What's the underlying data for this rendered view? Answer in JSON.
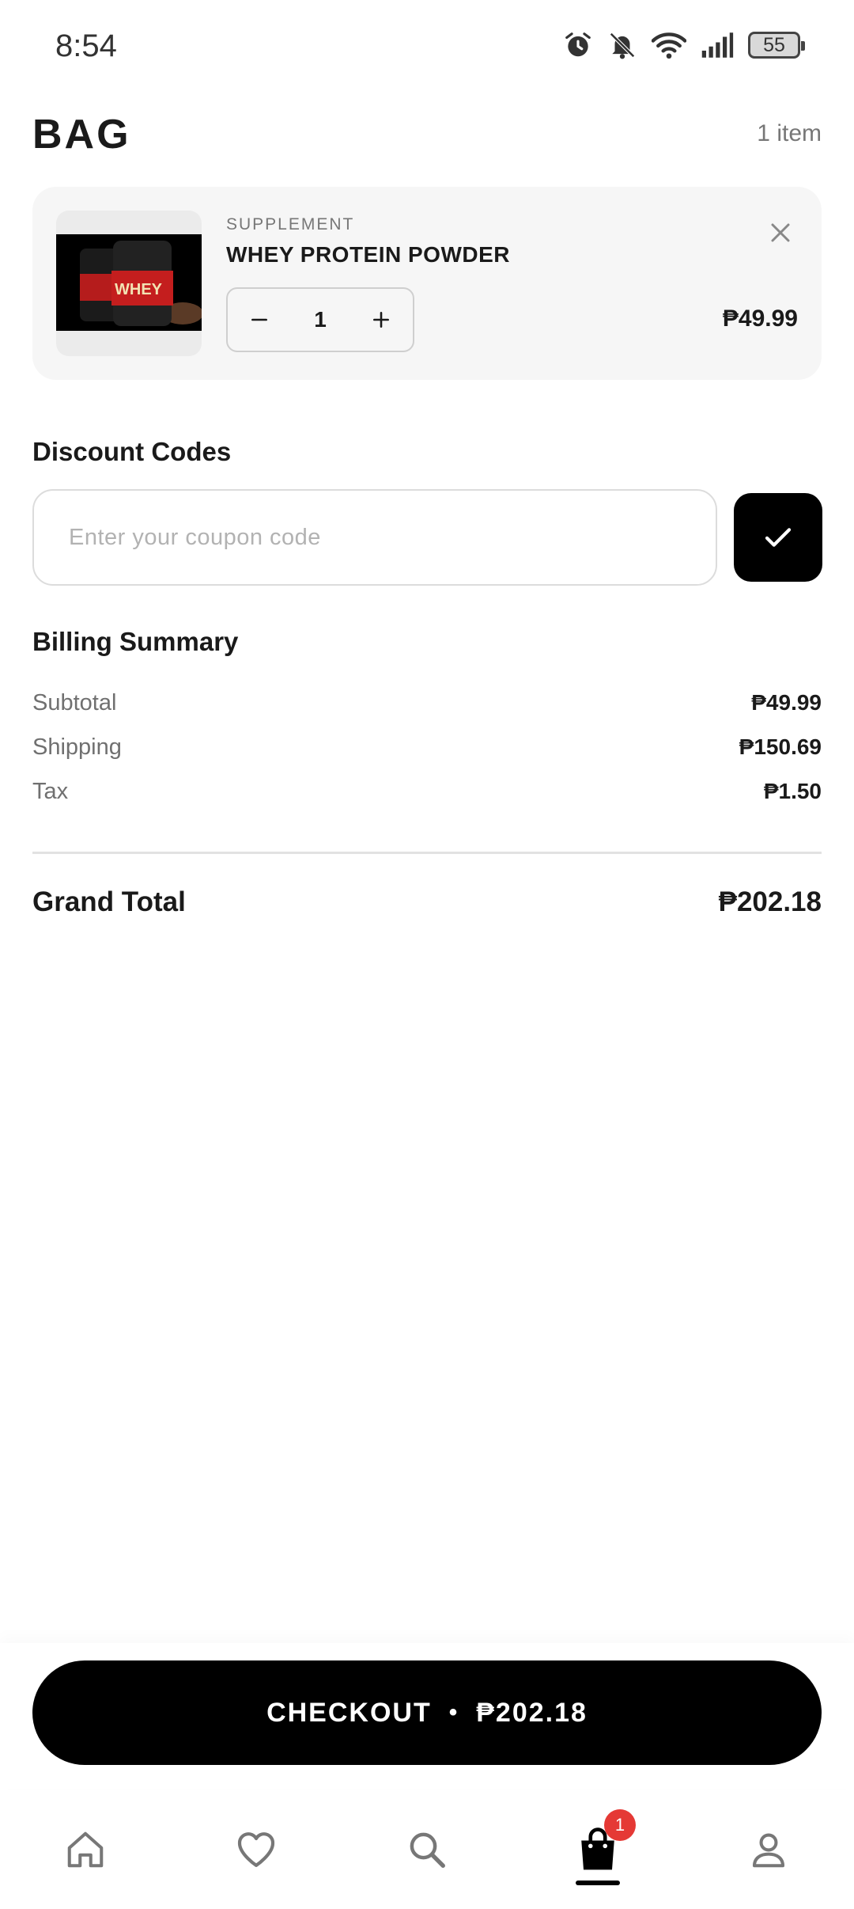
{
  "status_bar": {
    "time": "8:54",
    "battery": "55",
    "icons": [
      "alarm-icon",
      "bell-off-icon",
      "wifi-icon",
      "signal-icon",
      "battery-icon"
    ]
  },
  "header": {
    "title": "BAG",
    "item_count": "1 item"
  },
  "cart": {
    "items": [
      {
        "category": "SUPPLEMENT",
        "name": "WHEY PROTEIN POWDER",
        "quantity": "1",
        "price": "₱49.99",
        "image_label": "WHEY"
      }
    ]
  },
  "discount": {
    "title": "Discount Codes",
    "placeholder": "Enter your coupon code",
    "value": ""
  },
  "billing": {
    "title": "Billing Summary",
    "rows": [
      {
        "label": "Subtotal",
        "value": "₱49.99"
      },
      {
        "label": "Shipping",
        "value": "₱150.69"
      },
      {
        "label": "Tax",
        "value": "₱1.50"
      }
    ],
    "grand_total_label": "Grand Total",
    "grand_total_value": "₱202.18"
  },
  "checkout": {
    "label": "CHECKOUT",
    "separator": "•",
    "amount": "₱202.18"
  },
  "bottom_nav": {
    "items": [
      {
        "name": "home",
        "icon": "home-icon"
      },
      {
        "name": "wishlist",
        "icon": "heart-icon"
      },
      {
        "name": "search",
        "icon": "search-icon"
      },
      {
        "name": "bag",
        "icon": "shopping-bag-icon",
        "active": true
      },
      {
        "name": "profile",
        "icon": "user-icon"
      }
    ],
    "bag_badge": "1"
  },
  "colors": {
    "accent": "#000000",
    "badge": "#e53935",
    "card_bg": "#f6f6f6"
  }
}
